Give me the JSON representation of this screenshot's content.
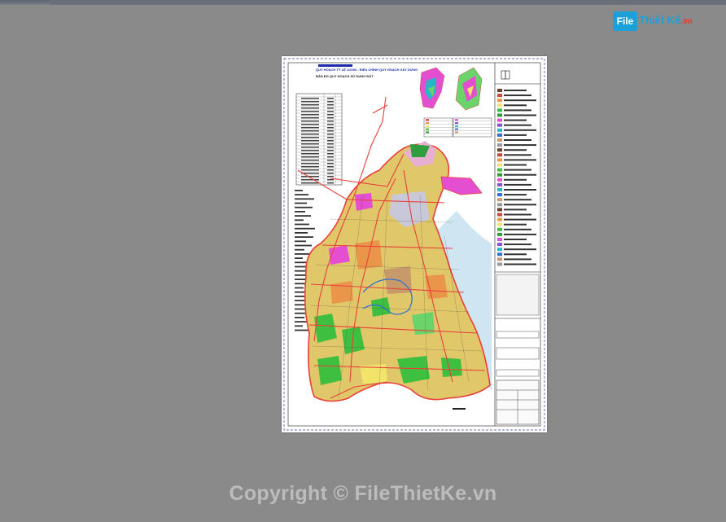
{
  "logo": {
    "badge": "File",
    "name": "Thiết Kế",
    "tld": ".vn"
  },
  "sheet": {
    "title_main": "QUY HOẠCH TỶ LỆ 1/2000 - ĐIỀU CHỈNH QUY HOẠCH XÂY DỰNG",
    "title_sub": "BẢN ĐỒ QUY HOẠCH SỬ DỤNG ĐẤT"
  },
  "watermark": {
    "text": "Copyright © FileThietKe.vn"
  },
  "colors": {
    "workspace": "#8a8a8a",
    "brand": "#1d9fd8",
    "road": "#e8403a",
    "residential": "#e0c76a",
    "green": "#3fbf3f",
    "pink": "#e34fd0",
    "sea": "#7fb8d8"
  }
}
